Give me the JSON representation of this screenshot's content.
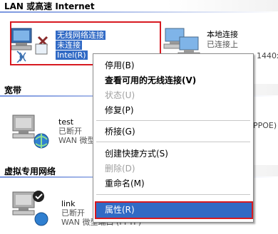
{
  "sections": {
    "lan_header": "LAN 或高速 Internet",
    "broadband_header": "宽带",
    "vpn_header": "虚拟专用网络"
  },
  "connections": {
    "wireless": {
      "name": "无线网络连接",
      "status": "未连接",
      "device": "Intel(R)"
    },
    "local": {
      "name": "本地连接",
      "status": "已连接上",
      "device_partial": "1440x"
    },
    "test": {
      "name": "test",
      "status": "已断开",
      "device": "WAN 微型",
      "device_partial": "PPOE)"
    },
    "link": {
      "name": "link",
      "status": "已断开",
      "device": "WAN 微型端口 (PPTP)"
    }
  },
  "context_menu": {
    "items": [
      {
        "label": "停用(B)",
        "bold": false,
        "disabled": false
      },
      {
        "label": "查看可用的无线连接(V)",
        "bold": true,
        "disabled": false
      },
      {
        "label": "状态(U)",
        "bold": false,
        "disabled": true
      },
      {
        "label": "修复(P)",
        "bold": false,
        "disabled": false
      },
      {
        "label": "桥接(G)",
        "bold": false,
        "disabled": false
      },
      {
        "label": "创建快捷方式(S)",
        "bold": false,
        "disabled": false
      },
      {
        "label": "删除(D)",
        "bold": false,
        "disabled": true
      },
      {
        "label": "重命名(M)",
        "bold": false,
        "disabled": false
      },
      {
        "label": "属性(R)",
        "bold": false,
        "disabled": false,
        "highlighted": true
      }
    ]
  },
  "colors": {
    "selection": "#316ac5",
    "annotation_red": "#d71920",
    "header_rule": "#7a96df"
  }
}
